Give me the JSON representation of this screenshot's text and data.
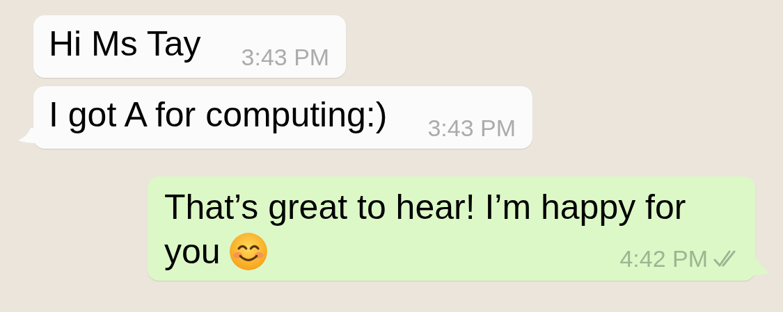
{
  "messages": [
    {
      "kind": "incoming",
      "lines": [
        "Hi Ms Tay"
      ],
      "time": "3:43 PM",
      "tail": false
    },
    {
      "kind": "incoming",
      "lines": [
        "I got A for computing:)"
      ],
      "time": "3:43 PM",
      "tail": true
    },
    {
      "kind": "outgoing",
      "lines": [
        "That’s great to hear! I’m happy for",
        "you"
      ],
      "trailing_icon": {
        "kind": "smiling_face"
      },
      "time": "4:42 PM",
      "tail": true,
      "read": true
    }
  ]
}
